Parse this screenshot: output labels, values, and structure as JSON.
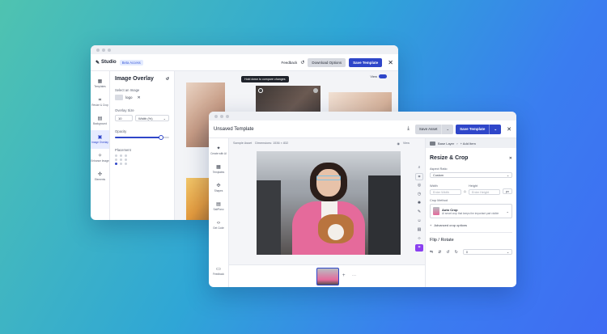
{
  "back": {
    "app_name": "Studio",
    "badge": "Beta Access",
    "feedback": "Feedback",
    "download_label": "Download Options",
    "save_label": "Save Template",
    "rail": [
      {
        "label": "Templates",
        "icon": "grid-icon"
      },
      {
        "label": "Resize & Crop",
        "icon": "crop-icon"
      },
      {
        "label": "Background",
        "icon": "layers-icon"
      },
      {
        "label": "Image Overlay",
        "icon": "image-icon",
        "active": true
      },
      {
        "label": "Enhance Image",
        "icon": "wand-icon"
      },
      {
        "label": "Elements",
        "icon": "shapes-icon"
      }
    ],
    "panel": {
      "title": "Image Overlay",
      "select_image_label": "Select an Image",
      "image_name": "logo",
      "overlay_size_label": "Overlay Size",
      "overlay_size_value": "10",
      "overlay_size_unit": "Width (%)",
      "opacity_label": "Opacity",
      "opacity": 0.85,
      "placement_label": "Placement"
    },
    "canvas": {
      "view_label": "View",
      "tooltip": "Hold down to compare changes"
    }
  },
  "front": {
    "title": "Unsaved Template",
    "save_asset": "Save Asset",
    "save_template": "Save Template",
    "rail": [
      {
        "label": "Create with AI",
        "icon": "sparkle-icon"
      },
      {
        "label": "Templates",
        "icon": "grid-icon"
      },
      {
        "label": "Shapes",
        "icon": "shapes-icon"
      },
      {
        "label": "SaltPano",
        "icon": "layers-icon"
      },
      {
        "label": "Get Code",
        "icon": "code-icon"
      },
      {
        "label": "Feedback",
        "icon": "chat-icon"
      }
    ],
    "subbar": {
      "asset": "Sample Asset",
      "dimensions": "Dimensions: 1536 × 832",
      "view": "View"
    },
    "panel": {
      "crumb_base": "Base Layer",
      "crumb_add": "+ Add Item",
      "title": "Resize & Crop",
      "aspect_label": "Aspect Ratio",
      "aspect_value": "Custom",
      "width_label": "Width",
      "height_label": "Height",
      "width_placeholder": "Enter Width",
      "height_placeholder": "Enter Height",
      "unit": "px",
      "crop_method_label": "Crop Method",
      "crop_method_title": "Auto Crop",
      "crop_method_desc": "AI smart crop that keeps the important part visible",
      "advanced": "Advanced crop options",
      "flip_title": "Flip / Rotate",
      "rotate_value": "0"
    }
  }
}
